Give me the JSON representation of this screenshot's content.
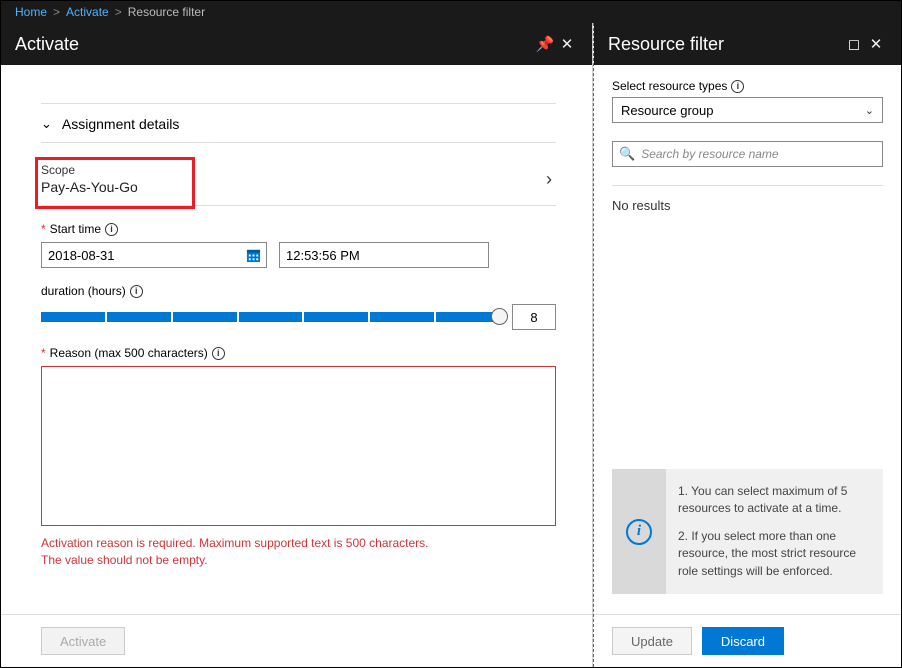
{
  "breadcrumb": {
    "home": "Home",
    "activate": "Activate",
    "current": "Resource filter"
  },
  "left": {
    "title": "Activate",
    "assignment_details": "Assignment details",
    "scope_label": "Scope",
    "scope_value": "Pay-As-You-Go",
    "start_time_label": "Start time",
    "date_value": "2018-08-31",
    "time_value": "12:53:56 PM",
    "duration_label": "duration (hours)",
    "duration_value": "8",
    "reason_label": "Reason (max 500 characters)",
    "error_line1": "Activation reason is required. Maximum supported text is 500 characters.",
    "error_line2": "The value should not be empty.",
    "activate_btn": "Activate"
  },
  "right": {
    "title": "Resource filter",
    "select_label": "Select resource types",
    "select_value": "Resource group",
    "search_placeholder": "Search by resource name",
    "no_results": "No results",
    "info1": "1. You can select maximum of 5 resources to activate at a time.",
    "info2": "2. If you select more than one resource, the most strict resource role settings will be enforced.",
    "update_btn": "Update",
    "discard_btn": "Discard"
  }
}
